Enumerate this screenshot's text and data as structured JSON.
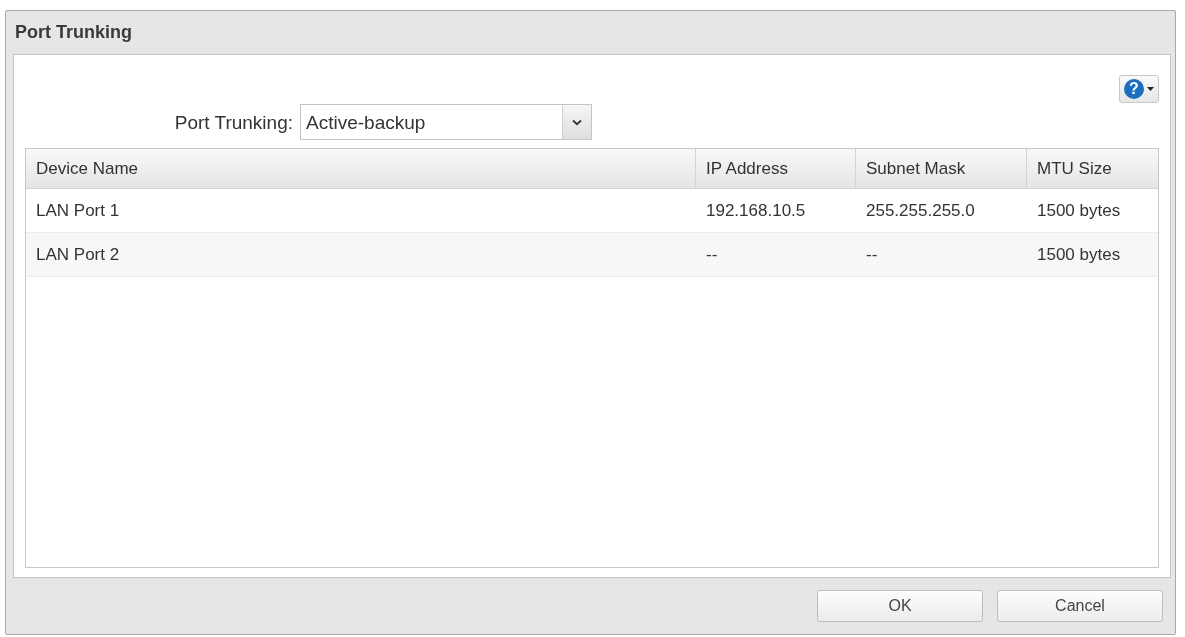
{
  "window": {
    "title": "Port Trunking"
  },
  "help_button": {
    "symbol": "?"
  },
  "port_trunking": {
    "label": "Port Trunking:",
    "value": "Active-backup"
  },
  "table": {
    "columns": [
      "Device Name",
      "IP Address",
      "Subnet Mask",
      "MTU Size"
    ],
    "rows": [
      {
        "cells": [
          "LAN Port 1",
          "192.168.10.5",
          "255.255.255.0",
          "1500 bytes"
        ]
      },
      {
        "cells": [
          "LAN Port 2",
          "--",
          "--",
          "1500 bytes"
        ]
      }
    ]
  },
  "buttons": [
    {
      "label": "OK"
    },
    {
      "label": "Cancel"
    }
  ]
}
